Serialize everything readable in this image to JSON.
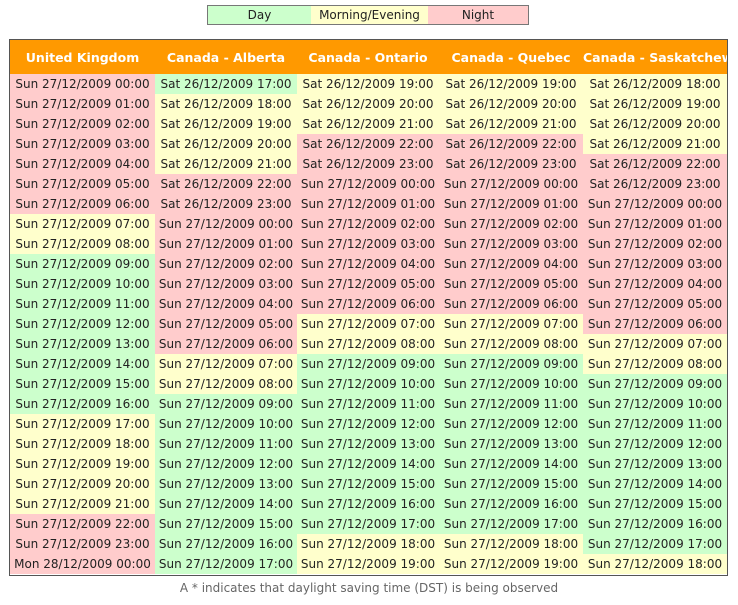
{
  "legend": {
    "day": "Day",
    "morning_evening": "Morning/Evening",
    "night": "Night"
  },
  "colors": {
    "day": "#ccffcc",
    "morning_evening": "#ffffcc",
    "night": "#ffcccc",
    "header": "#ff9900"
  },
  "headers": [
    "United Kingdom",
    "Canada - Alberta",
    "Canada - Ontario",
    "Canada - Quebec",
    "Canada - Saskatchewan"
  ],
  "rows": [
    [
      [
        "Sun 27/12/2009 00:00",
        "night"
      ],
      [
        "Sat 26/12/2009 17:00",
        "day"
      ],
      [
        "Sat 26/12/2009 19:00",
        "me"
      ],
      [
        "Sat 26/12/2009 19:00",
        "me"
      ],
      [
        "Sat 26/12/2009 18:00",
        "me"
      ]
    ],
    [
      [
        "Sun 27/12/2009 01:00",
        "night"
      ],
      [
        "Sat 26/12/2009 18:00",
        "me"
      ],
      [
        "Sat 26/12/2009 20:00",
        "me"
      ],
      [
        "Sat 26/12/2009 20:00",
        "me"
      ],
      [
        "Sat 26/12/2009 19:00",
        "me"
      ]
    ],
    [
      [
        "Sun 27/12/2009 02:00",
        "night"
      ],
      [
        "Sat 26/12/2009 19:00",
        "me"
      ],
      [
        "Sat 26/12/2009 21:00",
        "me"
      ],
      [
        "Sat 26/12/2009 21:00",
        "me"
      ],
      [
        "Sat 26/12/2009 20:00",
        "me"
      ]
    ],
    [
      [
        "Sun 27/12/2009 03:00",
        "night"
      ],
      [
        "Sat 26/12/2009 20:00",
        "me"
      ],
      [
        "Sat 26/12/2009 22:00",
        "night"
      ],
      [
        "Sat 26/12/2009 22:00",
        "night"
      ],
      [
        "Sat 26/12/2009 21:00",
        "me"
      ]
    ],
    [
      [
        "Sun 27/12/2009 04:00",
        "night"
      ],
      [
        "Sat 26/12/2009 21:00",
        "me"
      ],
      [
        "Sat 26/12/2009 23:00",
        "night"
      ],
      [
        "Sat 26/12/2009 23:00",
        "night"
      ],
      [
        "Sat 26/12/2009 22:00",
        "night"
      ]
    ],
    [
      [
        "Sun 27/12/2009 05:00",
        "night"
      ],
      [
        "Sat 26/12/2009 22:00",
        "night"
      ],
      [
        "Sun 27/12/2009 00:00",
        "night"
      ],
      [
        "Sun 27/12/2009 00:00",
        "night"
      ],
      [
        "Sat 26/12/2009 23:00",
        "night"
      ]
    ],
    [
      [
        "Sun 27/12/2009 06:00",
        "night"
      ],
      [
        "Sat 26/12/2009 23:00",
        "night"
      ],
      [
        "Sun 27/12/2009 01:00",
        "night"
      ],
      [
        "Sun 27/12/2009 01:00",
        "night"
      ],
      [
        "Sun 27/12/2009 00:00",
        "night"
      ]
    ],
    [
      [
        "Sun 27/12/2009 07:00",
        "me"
      ],
      [
        "Sun 27/12/2009 00:00",
        "night"
      ],
      [
        "Sun 27/12/2009 02:00",
        "night"
      ],
      [
        "Sun 27/12/2009 02:00",
        "night"
      ],
      [
        "Sun 27/12/2009 01:00",
        "night"
      ]
    ],
    [
      [
        "Sun 27/12/2009 08:00",
        "me"
      ],
      [
        "Sun 27/12/2009 01:00",
        "night"
      ],
      [
        "Sun 27/12/2009 03:00",
        "night"
      ],
      [
        "Sun 27/12/2009 03:00",
        "night"
      ],
      [
        "Sun 27/12/2009 02:00",
        "night"
      ]
    ],
    [
      [
        "Sun 27/12/2009 09:00",
        "day"
      ],
      [
        "Sun 27/12/2009 02:00",
        "night"
      ],
      [
        "Sun 27/12/2009 04:00",
        "night"
      ],
      [
        "Sun 27/12/2009 04:00",
        "night"
      ],
      [
        "Sun 27/12/2009 03:00",
        "night"
      ]
    ],
    [
      [
        "Sun 27/12/2009 10:00",
        "day"
      ],
      [
        "Sun 27/12/2009 03:00",
        "night"
      ],
      [
        "Sun 27/12/2009 05:00",
        "night"
      ],
      [
        "Sun 27/12/2009 05:00",
        "night"
      ],
      [
        "Sun 27/12/2009 04:00",
        "night"
      ]
    ],
    [
      [
        "Sun 27/12/2009 11:00",
        "day"
      ],
      [
        "Sun 27/12/2009 04:00",
        "night"
      ],
      [
        "Sun 27/12/2009 06:00",
        "night"
      ],
      [
        "Sun 27/12/2009 06:00",
        "night"
      ],
      [
        "Sun 27/12/2009 05:00",
        "night"
      ]
    ],
    [
      [
        "Sun 27/12/2009 12:00",
        "day"
      ],
      [
        "Sun 27/12/2009 05:00",
        "night"
      ],
      [
        "Sun 27/12/2009 07:00",
        "me"
      ],
      [
        "Sun 27/12/2009 07:00",
        "me"
      ],
      [
        "Sun 27/12/2009 06:00",
        "night"
      ]
    ],
    [
      [
        "Sun 27/12/2009 13:00",
        "day"
      ],
      [
        "Sun 27/12/2009 06:00",
        "night"
      ],
      [
        "Sun 27/12/2009 08:00",
        "me"
      ],
      [
        "Sun 27/12/2009 08:00",
        "me"
      ],
      [
        "Sun 27/12/2009 07:00",
        "me"
      ]
    ],
    [
      [
        "Sun 27/12/2009 14:00",
        "day"
      ],
      [
        "Sun 27/12/2009 07:00",
        "me"
      ],
      [
        "Sun 27/12/2009 09:00",
        "day"
      ],
      [
        "Sun 27/12/2009 09:00",
        "day"
      ],
      [
        "Sun 27/12/2009 08:00",
        "me"
      ]
    ],
    [
      [
        "Sun 27/12/2009 15:00",
        "day"
      ],
      [
        "Sun 27/12/2009 08:00",
        "me"
      ],
      [
        "Sun 27/12/2009 10:00",
        "day"
      ],
      [
        "Sun 27/12/2009 10:00",
        "day"
      ],
      [
        "Sun 27/12/2009 09:00",
        "day"
      ]
    ],
    [
      [
        "Sun 27/12/2009 16:00",
        "day"
      ],
      [
        "Sun 27/12/2009 09:00",
        "day"
      ],
      [
        "Sun 27/12/2009 11:00",
        "day"
      ],
      [
        "Sun 27/12/2009 11:00",
        "day"
      ],
      [
        "Sun 27/12/2009 10:00",
        "day"
      ]
    ],
    [
      [
        "Sun 27/12/2009 17:00",
        "me"
      ],
      [
        "Sun 27/12/2009 10:00",
        "day"
      ],
      [
        "Sun 27/12/2009 12:00",
        "day"
      ],
      [
        "Sun 27/12/2009 12:00",
        "day"
      ],
      [
        "Sun 27/12/2009 11:00",
        "day"
      ]
    ],
    [
      [
        "Sun 27/12/2009 18:00",
        "me"
      ],
      [
        "Sun 27/12/2009 11:00",
        "day"
      ],
      [
        "Sun 27/12/2009 13:00",
        "day"
      ],
      [
        "Sun 27/12/2009 13:00",
        "day"
      ],
      [
        "Sun 27/12/2009 12:00",
        "day"
      ]
    ],
    [
      [
        "Sun 27/12/2009 19:00",
        "me"
      ],
      [
        "Sun 27/12/2009 12:00",
        "day"
      ],
      [
        "Sun 27/12/2009 14:00",
        "day"
      ],
      [
        "Sun 27/12/2009 14:00",
        "day"
      ],
      [
        "Sun 27/12/2009 13:00",
        "day"
      ]
    ],
    [
      [
        "Sun 27/12/2009 20:00",
        "me"
      ],
      [
        "Sun 27/12/2009 13:00",
        "day"
      ],
      [
        "Sun 27/12/2009 15:00",
        "day"
      ],
      [
        "Sun 27/12/2009 15:00",
        "day"
      ],
      [
        "Sun 27/12/2009 14:00",
        "day"
      ]
    ],
    [
      [
        "Sun 27/12/2009 21:00",
        "me"
      ],
      [
        "Sun 27/12/2009 14:00",
        "day"
      ],
      [
        "Sun 27/12/2009 16:00",
        "day"
      ],
      [
        "Sun 27/12/2009 16:00",
        "day"
      ],
      [
        "Sun 27/12/2009 15:00",
        "day"
      ]
    ],
    [
      [
        "Sun 27/12/2009 22:00",
        "night"
      ],
      [
        "Sun 27/12/2009 15:00",
        "day"
      ],
      [
        "Sun 27/12/2009 17:00",
        "day"
      ],
      [
        "Sun 27/12/2009 17:00",
        "day"
      ],
      [
        "Sun 27/12/2009 16:00",
        "day"
      ]
    ],
    [
      [
        "Sun 27/12/2009 23:00",
        "night"
      ],
      [
        "Sun 27/12/2009 16:00",
        "day"
      ],
      [
        "Sun 27/12/2009 18:00",
        "me"
      ],
      [
        "Sun 27/12/2009 18:00",
        "me"
      ],
      [
        "Sun 27/12/2009 17:00",
        "day"
      ]
    ],
    [
      [
        "Mon 28/12/2009 00:00",
        "night"
      ],
      [
        "Sun 27/12/2009 17:00",
        "day"
      ],
      [
        "Sun 27/12/2009 19:00",
        "me"
      ],
      [
        "Sun 27/12/2009 19:00",
        "me"
      ],
      [
        "Sun 27/12/2009 18:00",
        "me"
      ]
    ]
  ],
  "footer": {
    "dst_note": "A * indicates that daylight saving time (DST) is being observed"
  }
}
